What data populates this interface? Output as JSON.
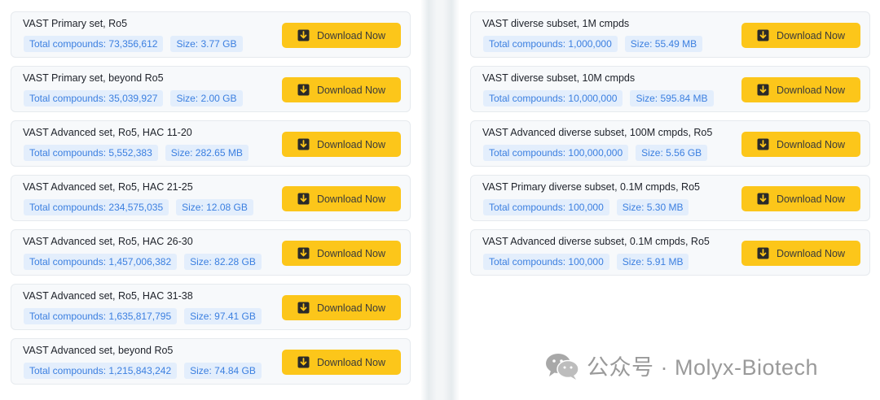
{
  "download_label": "Download Now",
  "left_cards": [
    {
      "title": "VAST Primary set, Ro5",
      "compounds": "Total compounds: 73,356,612",
      "size": "Size: 3.77 GB"
    },
    {
      "title": "VAST Primary set, beyond Ro5",
      "compounds": "Total compounds: 35,039,927",
      "size": "Size: 2.00 GB"
    },
    {
      "title": "VAST Advanced set, Ro5, HAC 11-20",
      "compounds": "Total compounds: 5,552,383",
      "size": "Size: 282.65 MB"
    },
    {
      "title": "VAST Advanced set, Ro5, HAC 21-25",
      "compounds": "Total compounds: 234,575,035",
      "size": "Size: 12.08 GB"
    },
    {
      "title": "VAST Advanced set, Ro5, HAC 26-30",
      "compounds": "Total compounds: 1,457,006,382",
      "size": "Size: 82.28 GB"
    },
    {
      "title": "VAST Advanced set, Ro5, HAC 31-38",
      "compounds": "Total compounds: 1,635,817,795",
      "size": "Size: 97.41 GB"
    },
    {
      "title": "VAST Advanced set, beyond Ro5",
      "compounds": "Total compounds: 1,215,843,242",
      "size": "Size: 74.84 GB"
    }
  ],
  "right_cards": [
    {
      "title": "VAST diverse subset, 1M cmpds",
      "compounds": "Total compounds: 1,000,000",
      "size": "Size: 55.49 MB"
    },
    {
      "title": "VAST diverse subset, 10M cmpds",
      "compounds": "Total compounds: 10,000,000",
      "size": "Size: 595.84 MB"
    },
    {
      "title": "VAST Advanced diverse subset, 100M cmpds, Ro5",
      "compounds": "Total compounds: 100,000,000",
      "size": "Size: 5.56 GB"
    },
    {
      "title": "VAST Primary diverse subset, 0.1M cmpds, Ro5",
      "compounds": "Total compounds: 100,000",
      "size": "Size: 5.30 MB"
    },
    {
      "title": "VAST Advanced diverse subset, 0.1M cmpds, Ro5",
      "compounds": "Total compounds: 100,000",
      "size": "Size: 5.91 MB"
    }
  ],
  "watermark": {
    "text": "公众号 · Molyx-Biotech",
    "icon": "wechat-icon"
  },
  "colors": {
    "button": "#fcc61a",
    "tag_bg": "#e3eefc",
    "tag_text": "#3b7fe0"
  }
}
